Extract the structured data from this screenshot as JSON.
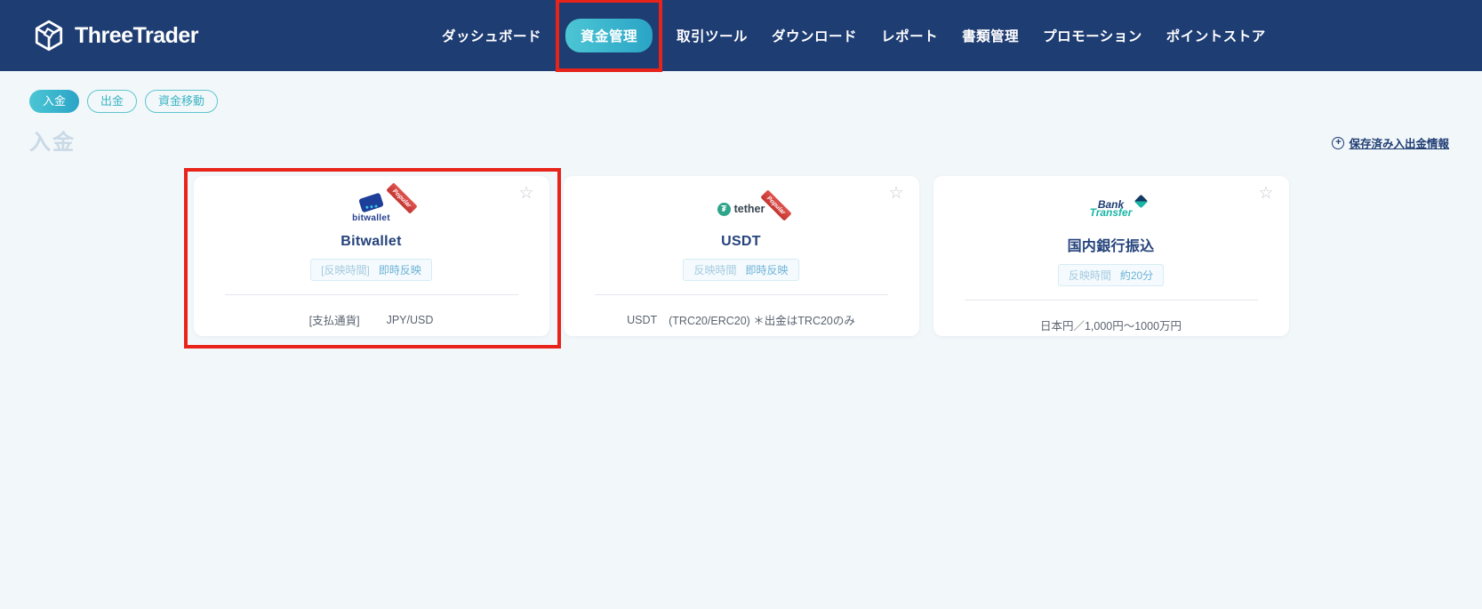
{
  "header": {
    "brand": "ThreeTrader",
    "nav": [
      {
        "label": "ダッシュボード",
        "active": false
      },
      {
        "label": "資金管理",
        "active": true,
        "annotated": true
      },
      {
        "label": "取引ツール",
        "active": false
      },
      {
        "label": "ダウンロード",
        "active": false
      },
      {
        "label": "レポート",
        "active": false
      },
      {
        "label": "書類管理",
        "active": false
      },
      {
        "label": "プロモーション",
        "active": false
      },
      {
        "label": "ポイントストア",
        "active": false
      }
    ]
  },
  "tabs": [
    {
      "label": "入金",
      "active": true
    },
    {
      "label": "出金",
      "active": false
    },
    {
      "label": "資金移動",
      "active": false
    }
  ],
  "page": {
    "title": "入金",
    "saved_info_link": "保存済み入出金情報"
  },
  "cards": [
    {
      "name": "Bitwallet",
      "logo_text": "bitwallet",
      "ribbon": "Popular",
      "badge_label": "[反映時間]",
      "badge_value": "即時反映",
      "detail_label": "[支払通貨]",
      "detail_value": "JPY/USD",
      "favorited": false,
      "annotated": true
    },
    {
      "name": "USDT",
      "logo_text": "tether",
      "logo_symbol": "₮",
      "ribbon": "Popular",
      "badge_label": "反映時間",
      "badge_value": "即時反映",
      "detail_label": "USDT",
      "detail_value": "(TRC20/ERC20) ＊出金はTRC20のみ",
      "favorited": false,
      "annotated": false
    },
    {
      "name": "国内銀行振込",
      "logo_line1": "Bank",
      "logo_line2": "Transfer",
      "badge_label": "反映時間",
      "badge_value": "約20分",
      "detail_label": "",
      "detail_value": "日本円／1,000円～1000万円",
      "favorited": false,
      "annotated": false
    }
  ],
  "icons": {
    "favorite_star": "☆",
    "saved_plus": "+"
  },
  "colors": {
    "header_bg": "#1e3d73",
    "accent_teal": "#3cb8c9",
    "annotation_red": "#e8231a",
    "page_bg": "#f2f7fa",
    "title_pale_blue": "#c9d9e6"
  }
}
